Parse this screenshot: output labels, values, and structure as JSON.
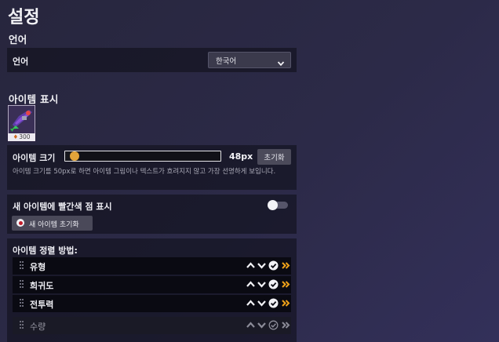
{
  "title": "설정",
  "language": {
    "section": "언어",
    "label": "언어",
    "selected": "한국어"
  },
  "item_display": {
    "section": "아이템 표시",
    "preview_power": "300",
    "size": {
      "label": "아이템 크기",
      "value_text": "48px",
      "fraction": 0.03,
      "reset": "초기화",
      "description": "아이템 크기를 50px로 하면 아이템 그림이나 텍스트가 흐려지지 않고 가장 선명하게 보입니다."
    },
    "new_dot": {
      "label": "새 아이템에 빨간색 점 표시",
      "enabled": false,
      "reset_button": "새 아이템 초기화"
    },
    "sort": {
      "title": "아이템 정렬 방법:",
      "items": [
        {
          "label": "유형",
          "enabled": true
        },
        {
          "label": "희귀도",
          "enabled": true
        },
        {
          "label": "전투력",
          "enabled": true
        },
        {
          "label": "수량",
          "enabled": false
        }
      ]
    }
  },
  "colors": {
    "accent": "#e2a43a",
    "sort_arrow": "#f0a21a",
    "new_dot": "#c21e2c"
  }
}
